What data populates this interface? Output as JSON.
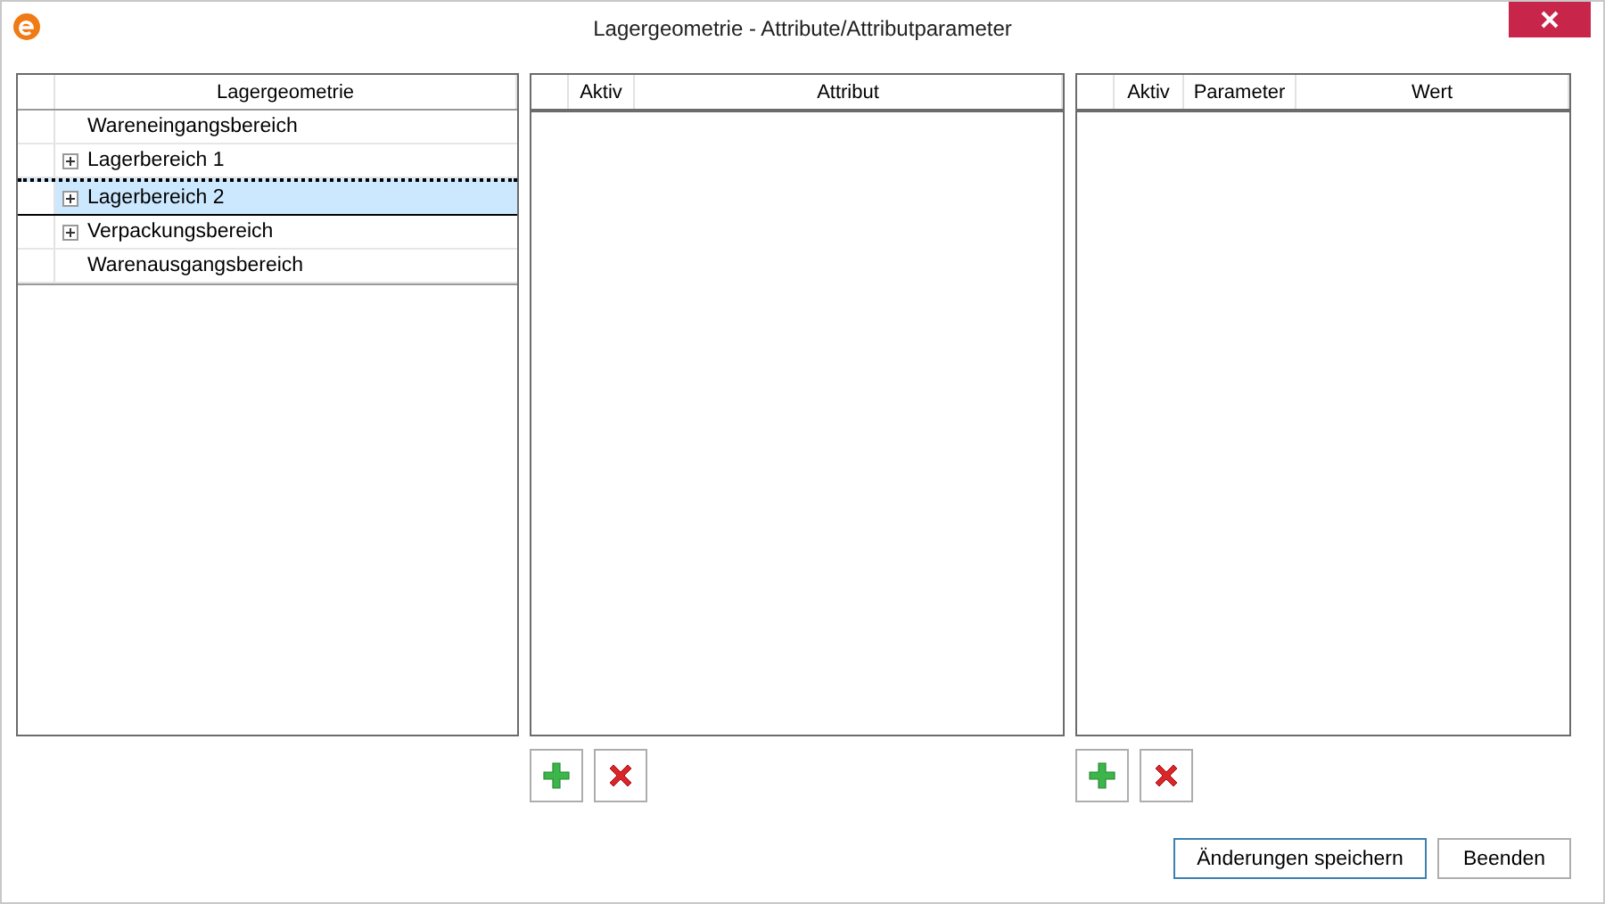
{
  "window": {
    "title": "Lagergeometrie - Attribute/Attributparameter"
  },
  "tree": {
    "header": "Lagergeometrie",
    "items": [
      {
        "label": "Wareneingangsbereich",
        "expandable": false,
        "selected": false
      },
      {
        "label": "Lagerbereich 1",
        "expandable": true,
        "selected": false
      },
      {
        "label": "Lagerbereich 2",
        "expandable": true,
        "selected": true
      },
      {
        "label": "Verpackungsbereich",
        "expandable": true,
        "selected": false
      },
      {
        "label": "Warenausgangsbereich",
        "expandable": false,
        "selected": false
      }
    ]
  },
  "attribute_grid": {
    "columns": [
      "Aktiv",
      "Attribut"
    ]
  },
  "parameter_grid": {
    "columns": [
      "Aktiv",
      "Parameter",
      "Wert"
    ]
  },
  "buttons": [
    "Änderungen speichern",
    "Beenden"
  ]
}
